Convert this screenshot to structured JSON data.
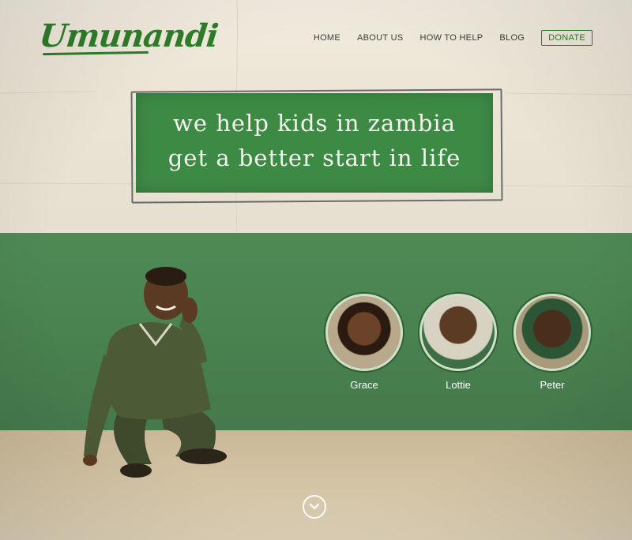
{
  "brand": {
    "logo": "Umunandi",
    "primary_color": "#2f7d2b",
    "wall_green": "#4a8250"
  },
  "nav": {
    "items": [
      "HOME",
      "ABOUT US",
      "HOW TO HELP",
      "BLOG"
    ],
    "donate": "DONATE"
  },
  "hero": {
    "line1": "we help kids in zambia",
    "line2": "get a better start in life"
  },
  "kids": [
    {
      "name": "Grace"
    },
    {
      "name": "Lottie"
    },
    {
      "name": "Peter"
    }
  ],
  "scroll": {
    "icon": "chevron-down-icon"
  }
}
